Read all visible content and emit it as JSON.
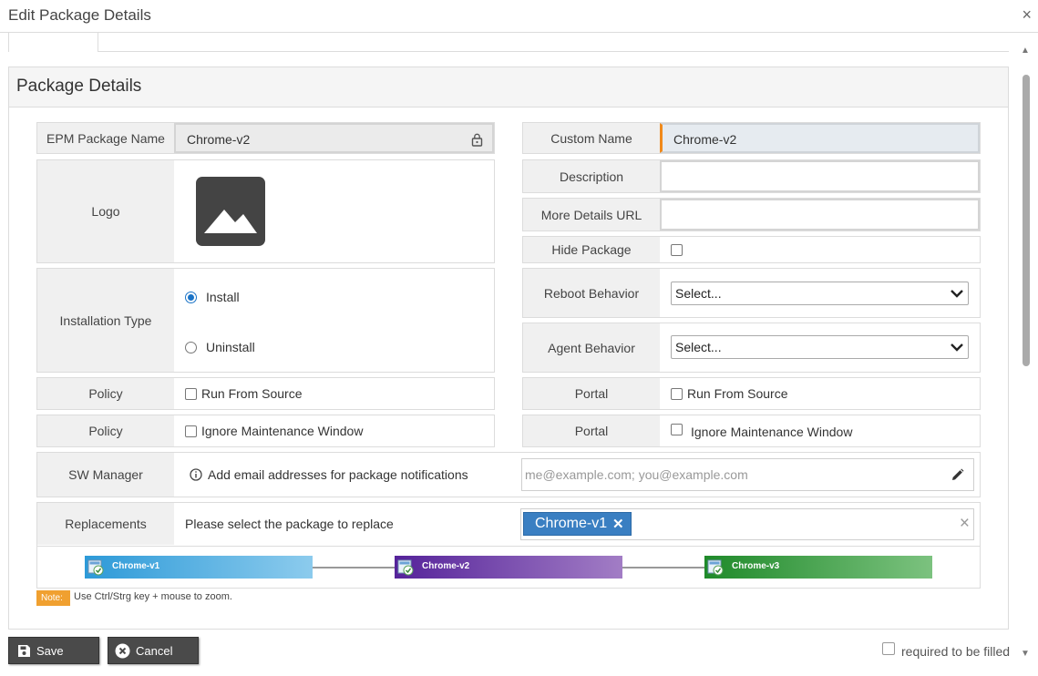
{
  "window": {
    "title": "Edit Package Details",
    "close_glyph": "×"
  },
  "panel": {
    "title": "Package Details"
  },
  "left": {
    "package_name": {
      "label": "EPM Package Name",
      "value": "Chrome-v2",
      "icon": "lock-icon"
    },
    "logo": {
      "label": "Logo",
      "icon": "image-placeholder-icon"
    },
    "installation_type": {
      "label": "Installation Type",
      "options": [
        "Install",
        "Uninstall"
      ],
      "selected": "Install"
    },
    "policy_1": {
      "label": "Policy",
      "checkbox_label": "Run From Source",
      "checked": false
    },
    "policy_2": {
      "label": "Policy",
      "checkbox_label": "Ignore Maintenance Window",
      "checked": false
    }
  },
  "right": {
    "custom_name": {
      "label": "Custom Name",
      "value": "Chrome-v2",
      "accent_color": "#f08a1c"
    },
    "description": {
      "label": "Description",
      "value": ""
    },
    "more_details_url": {
      "label": "More Details URL",
      "value": ""
    },
    "hide_package": {
      "label": "Hide Package",
      "checked": false
    },
    "reboot_behavior": {
      "label": "Reboot Behavior",
      "selected": "Select..."
    },
    "agent_behavior": {
      "label": "Agent Behavior",
      "selected": "Select..."
    },
    "portal_1": {
      "label": "Portal",
      "checkbox_label": "Run From Source",
      "checked": false
    },
    "portal_2": {
      "label": "Portal",
      "checkbox_label": "Ignore Maintenance Window",
      "checked": false
    }
  },
  "sw_manager": {
    "label": "SW Manager",
    "info_text": "Add email addresses for package notifications",
    "email_placeholder": "me@example.com; you@example.com",
    "icons": [
      "info-icon",
      "pencil-icon"
    ]
  },
  "replacements": {
    "label": "Replacements",
    "prompt": "Please select the package to replace",
    "selected_tag": "Chrome-v1",
    "tag_remove_glyph": "✕",
    "clear_glyph": "×",
    "tag_color": "#3a7fc2"
  },
  "version_flow": [
    {
      "name": "Chrome-v1",
      "color_from": "#2d9ad8",
      "color_to": "#8ccbed"
    },
    {
      "name": "Chrome-v2",
      "color_from": "#55239a",
      "color_to": "#a27dc5"
    },
    {
      "name": "Chrome-v3",
      "color_from": "#1f8a2a",
      "color_to": "#7cc27f"
    }
  ],
  "note": {
    "badge": "Note:",
    "text": "Use Ctrl/Strg key + mouse to zoom."
  },
  "footer": {
    "save_label": "Save",
    "cancel_label": "Cancel",
    "required_text": "required to be filled"
  }
}
